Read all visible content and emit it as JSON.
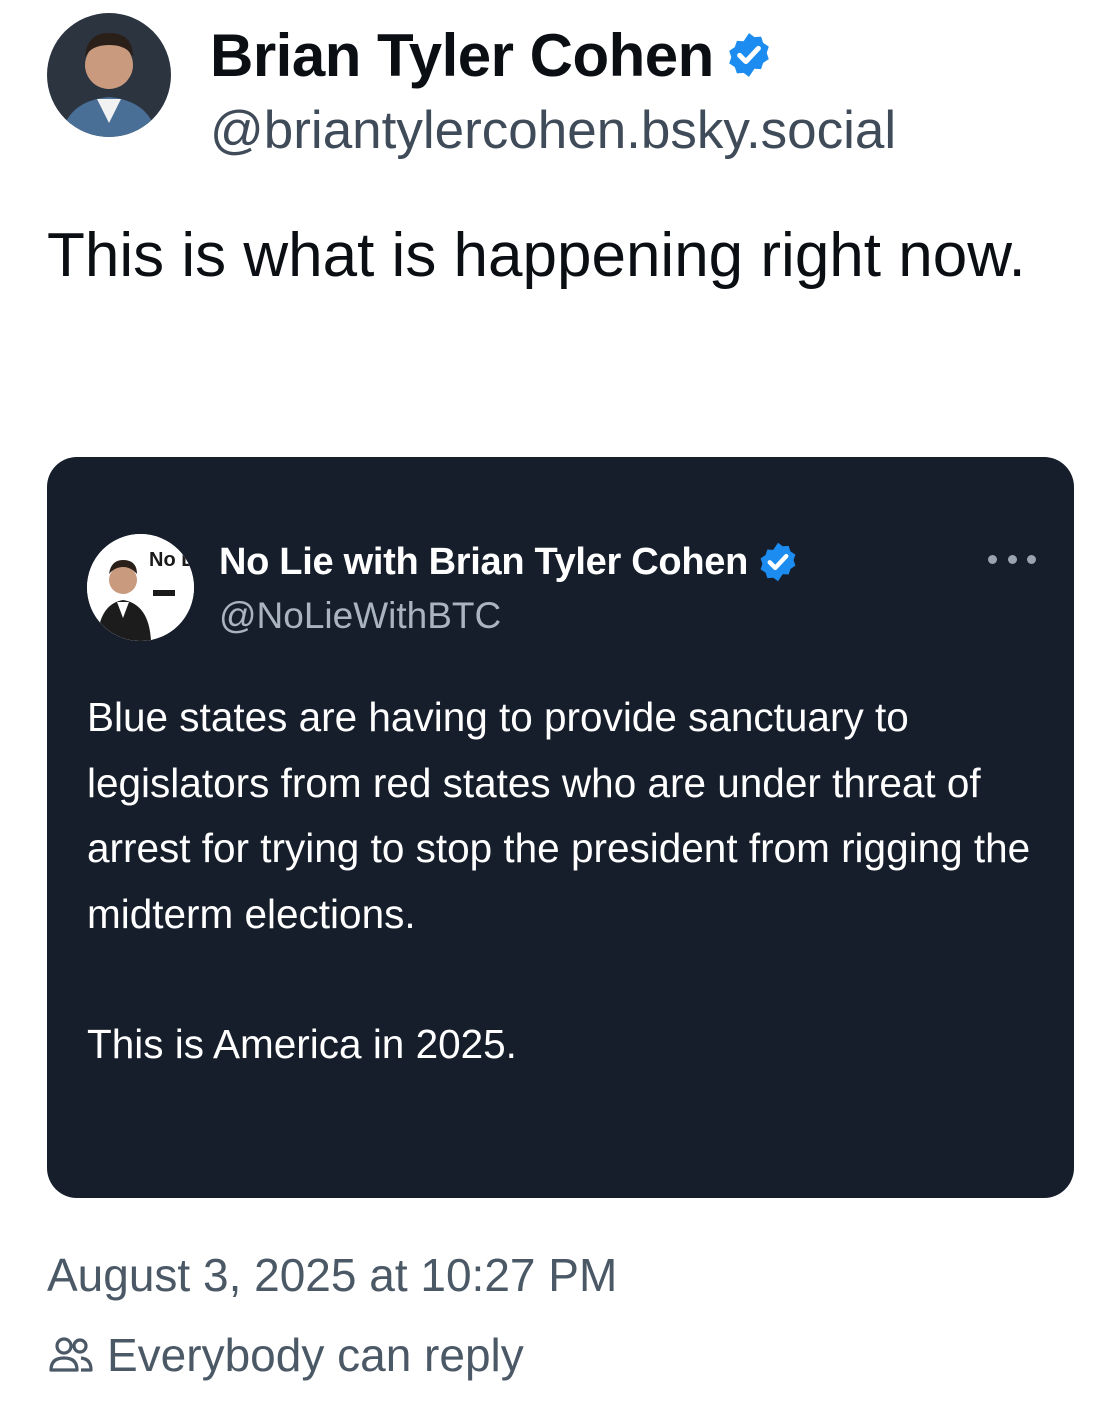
{
  "post": {
    "author": {
      "display_name": "Brian Tyler Cohen",
      "handle": "@briantylercohen.bsky.social",
      "verified_icon": "verified-check-icon",
      "avatar": "avatar-photo"
    },
    "text": "This is what is happening right now.",
    "timestamp": "August 3, 2025 at 10:27 PM",
    "reply_setting": "Everybody can reply",
    "reply_icon": "people-icon"
  },
  "quoted": {
    "display_name": "No Lie with Brian Tyler Cohen",
    "handle": "@NoLieWithBTC",
    "verified_icon": "verified-check-icon",
    "avatar_logo_text": "No Lie",
    "menu_icon": "more-options-icon",
    "paragraphs": [
      "Blue states are having to provide sanctuary to legislators from red states who are under threat of arrest for trying to stop the president from rigging the midterm elections.",
      "This is America in 2025."
    ]
  },
  "colors": {
    "verified_blue": "#1d8cf0",
    "card_background": "#161e2b",
    "secondary_text": "#4b5866"
  }
}
